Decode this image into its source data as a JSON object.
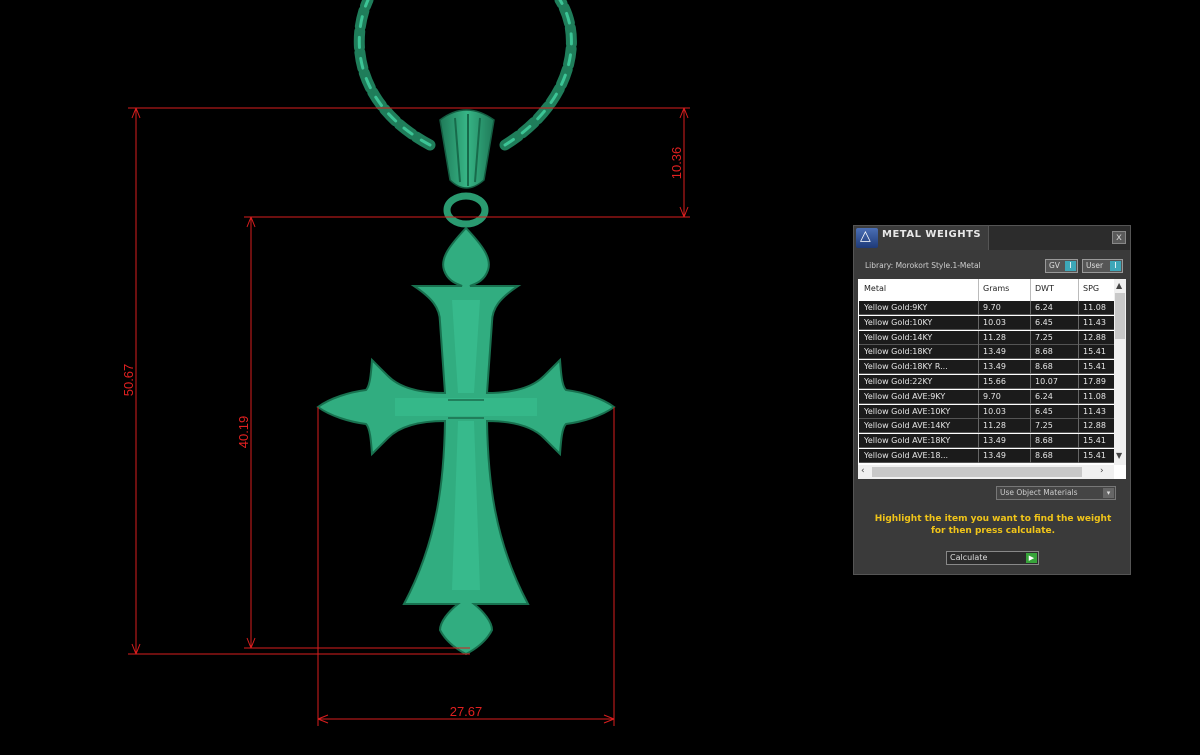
{
  "dimensions": {
    "total_height": "50.67",
    "bail_height": "10.36",
    "cross_height": "40.19",
    "cross_width": "27.67"
  },
  "panel": {
    "title": "METAL WEIGHTS",
    "close_label": "x",
    "library": "Library: Morokort Style.1-Metal",
    "gv_label": "GV",
    "user_label": "User",
    "toggle_knob": "I",
    "columns": [
      "Metal",
      "Grams",
      "DWT",
      "SPG"
    ],
    "rows": [
      {
        "metal": "Yellow Gold:9KY",
        "grams": "9.70",
        "dwt": "6.24",
        "spg": "11.08"
      },
      {
        "metal": "Yellow Gold:10KY",
        "grams": "10.03",
        "dwt": "6.45",
        "spg": "11.43"
      },
      {
        "metal": "Yellow Gold:14KY",
        "grams": "11.28",
        "dwt": "7.25",
        "spg": "12.88"
      },
      {
        "metal": "Yellow Gold:18KY",
        "grams": "13.49",
        "dwt": "8.68",
        "spg": "15.41"
      },
      {
        "metal": "Yellow Gold:18KY R...",
        "grams": "13.49",
        "dwt": "8.68",
        "spg": "15.41"
      },
      {
        "metal": "Yellow Gold:22KY",
        "grams": "15.66",
        "dwt": "10.07",
        "spg": "17.89"
      },
      {
        "metal": "Yellow Gold AVE:9KY",
        "grams": "9.70",
        "dwt": "6.24",
        "spg": "11.08"
      },
      {
        "metal": "Yellow Gold AVE:10KY",
        "grams": "10.03",
        "dwt": "6.45",
        "spg": "11.43"
      },
      {
        "metal": "Yellow Gold AVE:14KY",
        "grams": "11.28",
        "dwt": "7.25",
        "spg": "12.88"
      },
      {
        "metal": "Yellow Gold AVE:18KY",
        "grams": "13.49",
        "dwt": "8.68",
        "spg": "15.41"
      },
      {
        "metal": "Yellow Gold AVE:18...",
        "grams": "13.49",
        "dwt": "8.68",
        "spg": "15.41"
      }
    ],
    "materials_dropdown": "Use Object Materials",
    "instructions_line1": "Highlight the item you want to find the weight",
    "instructions_line2": "for then press calculate.",
    "calculate_label": "Calculate",
    "colors": {
      "model": "#2fa57a",
      "dimension": "#d81e1e",
      "instructions": "#f0c419",
      "toggle_accent": "#3da7b8",
      "calculate_accent": "#37a33a"
    }
  }
}
